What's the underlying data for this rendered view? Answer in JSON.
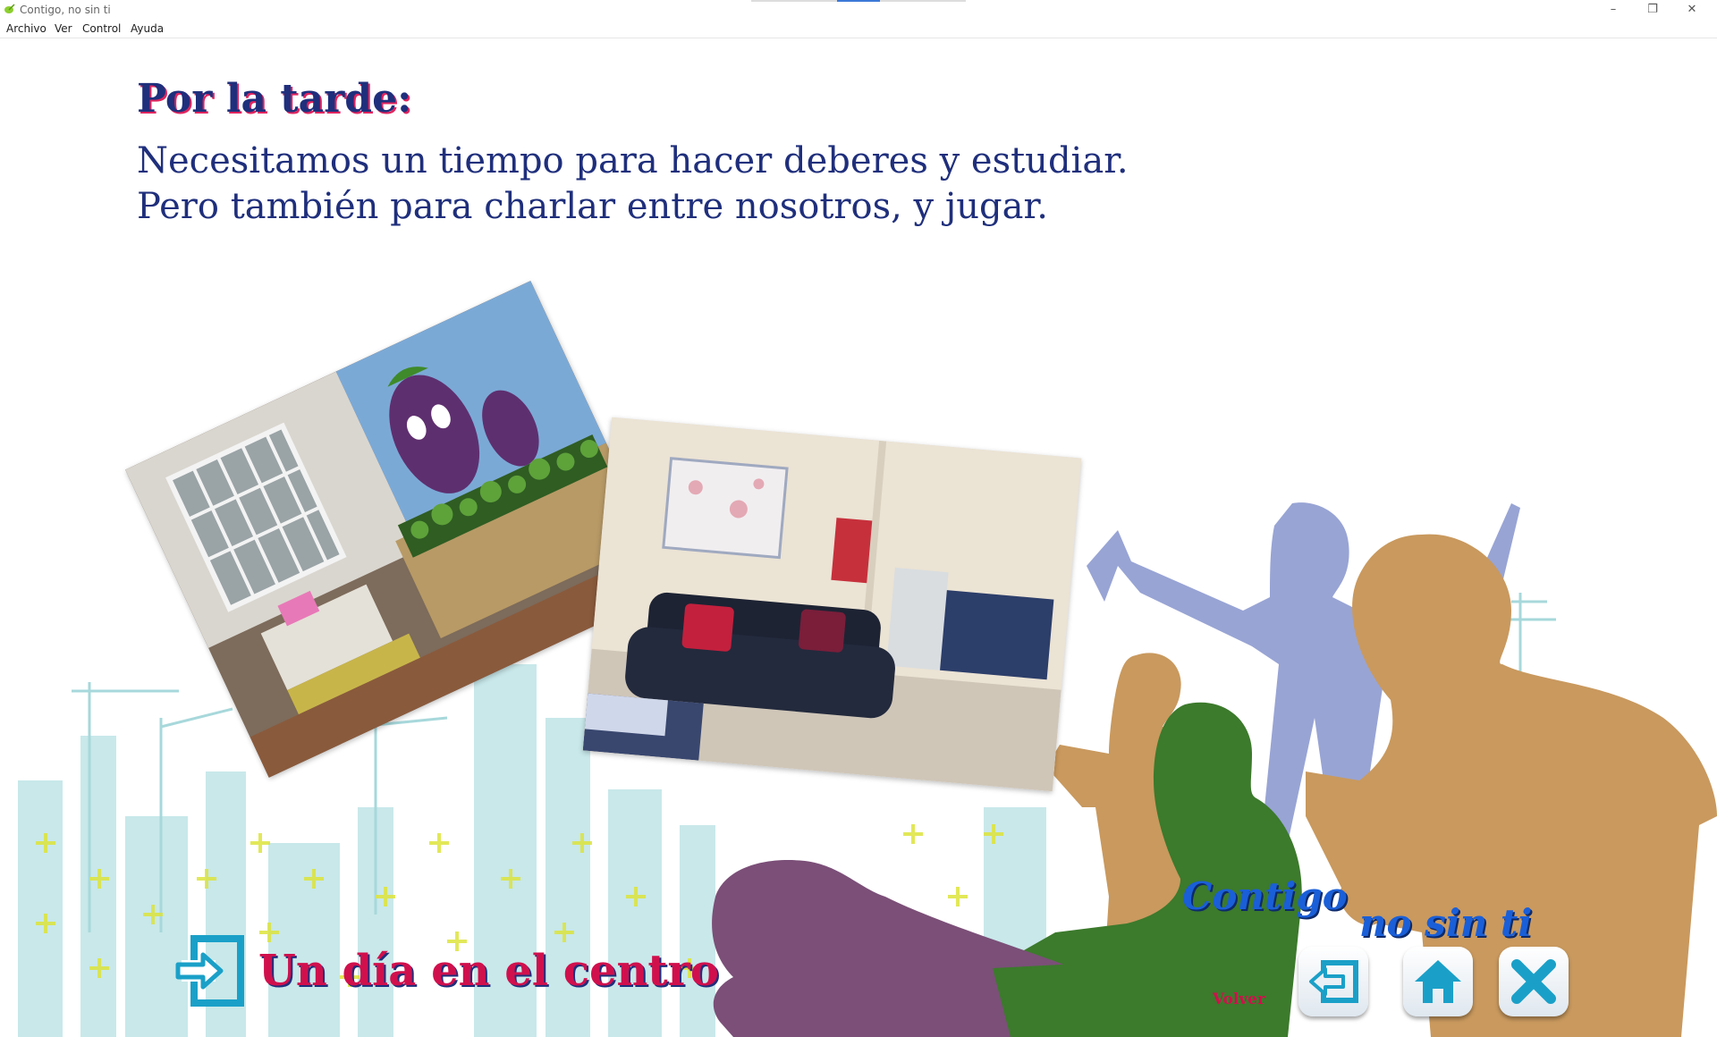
{
  "window": {
    "title": "Contigo, no sin ti",
    "controls": {
      "minimize": "–",
      "restore": "❐",
      "close": "✕"
    }
  },
  "menu": [
    "Archivo",
    "Ver",
    "Control",
    "Ayuda"
  ],
  "slide": {
    "heading": "Por la tarde:",
    "paragraph_lines": [
      "Necesitamos un tiempo para hacer deberes y estudiar.",
      "Pero también para charlar entre nosotros, y jugar."
    ]
  },
  "navigation": {
    "section_link": "Un día en el centro",
    "brand_line1": "Contigo",
    "brand_line2": "no sin ti",
    "back_label": "Volver"
  },
  "icons": {
    "section": "enter-arrow-icon",
    "back": "back-arrow-icon",
    "home": "home-icon",
    "close": "close-icon"
  },
  "colors": {
    "heading": "#1f2f7c",
    "accent": "#d0104d",
    "icon_teal": "#1aa0c8",
    "silhouette_purple": "#7b4f78",
    "silhouette_green": "#3c7a2c",
    "silhouette_tan": "#c9995e",
    "silhouette_lavender": "#98a4d4",
    "city_teal": "#b9e2e4",
    "plus_yellow": "#e5e640"
  }
}
